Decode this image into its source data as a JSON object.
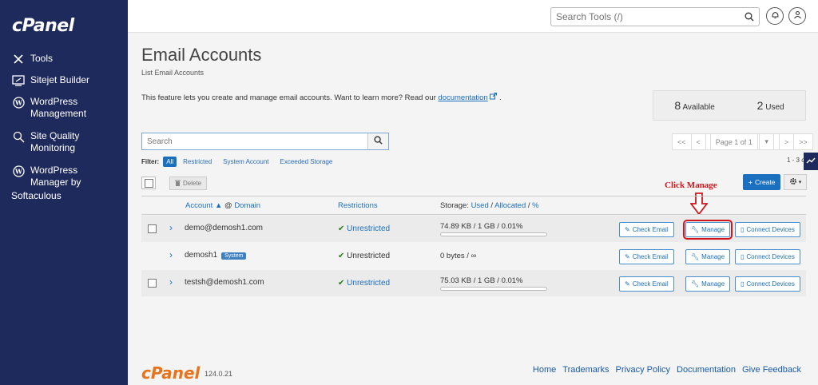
{
  "sidebar": {
    "logo": "cPanel",
    "items": [
      {
        "icon": "tools-icon",
        "label": "Tools",
        "sub": ""
      },
      {
        "icon": "sitejet-icon",
        "label": "Sitejet Builder",
        "sub": ""
      },
      {
        "icon": "wordpress-icon",
        "label": "WordPress",
        "sub": "Management"
      },
      {
        "icon": "site-quality-icon",
        "label": "Site Quality",
        "sub": "Monitoring"
      },
      {
        "icon": "wordpress-icon",
        "label": "WordPress",
        "sub": "Manager by"
      }
    ],
    "softaculous": "Softaculous"
  },
  "topbar": {
    "search_placeholder": "Search Tools (/)"
  },
  "page": {
    "title": "Email Accounts",
    "breadcrumb": "List Email Accounts",
    "intro_text": "This feature lets you create and manage email accounts. Want to learn more? Read our ",
    "intro_link": "documentation",
    "intro_end": "."
  },
  "stats": {
    "available_num": "8",
    "available_label": "Available",
    "used_num": "2",
    "used_label": "Used"
  },
  "search": {
    "placeholder": "Search"
  },
  "pager": {
    "first": "<<",
    "prev": "<",
    "page": "Page 1 of 1",
    "next": ">",
    "last": ">>"
  },
  "filter": {
    "label": "Filter:",
    "all": "All",
    "restricted": "Restricted",
    "system": "System Account",
    "exceeded": "Exceeded Storage",
    "count": "1 - 3 of"
  },
  "toolbar": {
    "delete": "Delete",
    "create": "Create"
  },
  "annotation": "Click Manage",
  "table": {
    "col_account": "Account",
    "col_domain": "Domain",
    "col_restrictions": "Restrictions",
    "col_storage": "Storage:",
    "col_used": "Used",
    "col_allocated": "Allocated",
    "col_percent": "%",
    "rows": [
      {
        "account": "demo@demosh1.com",
        "restriction": "Unrestricted",
        "storage": "74.89 KB / 1 GB / 0.01%",
        "usage_fraction": 0.0001
      },
      {
        "account": "demosh1",
        "badge": "System",
        "restriction": "Unrestricted",
        "storage": "0 bytes / ∞"
      },
      {
        "account": "testsh@demosh1.com",
        "restriction": "Unrestricted",
        "storage": "75.03 KB / 1 GB / 0.01%",
        "usage_fraction": 0.0001
      }
    ],
    "actions": {
      "check_email": "Check Email",
      "manage": "Manage",
      "connect": "Connect Devices"
    }
  },
  "footer": {
    "logo": "cPanel",
    "version": "124.0.21",
    "links": [
      "Home",
      "Trademarks",
      "Privacy Policy",
      "Documentation",
      "Give Feedback"
    ]
  }
}
